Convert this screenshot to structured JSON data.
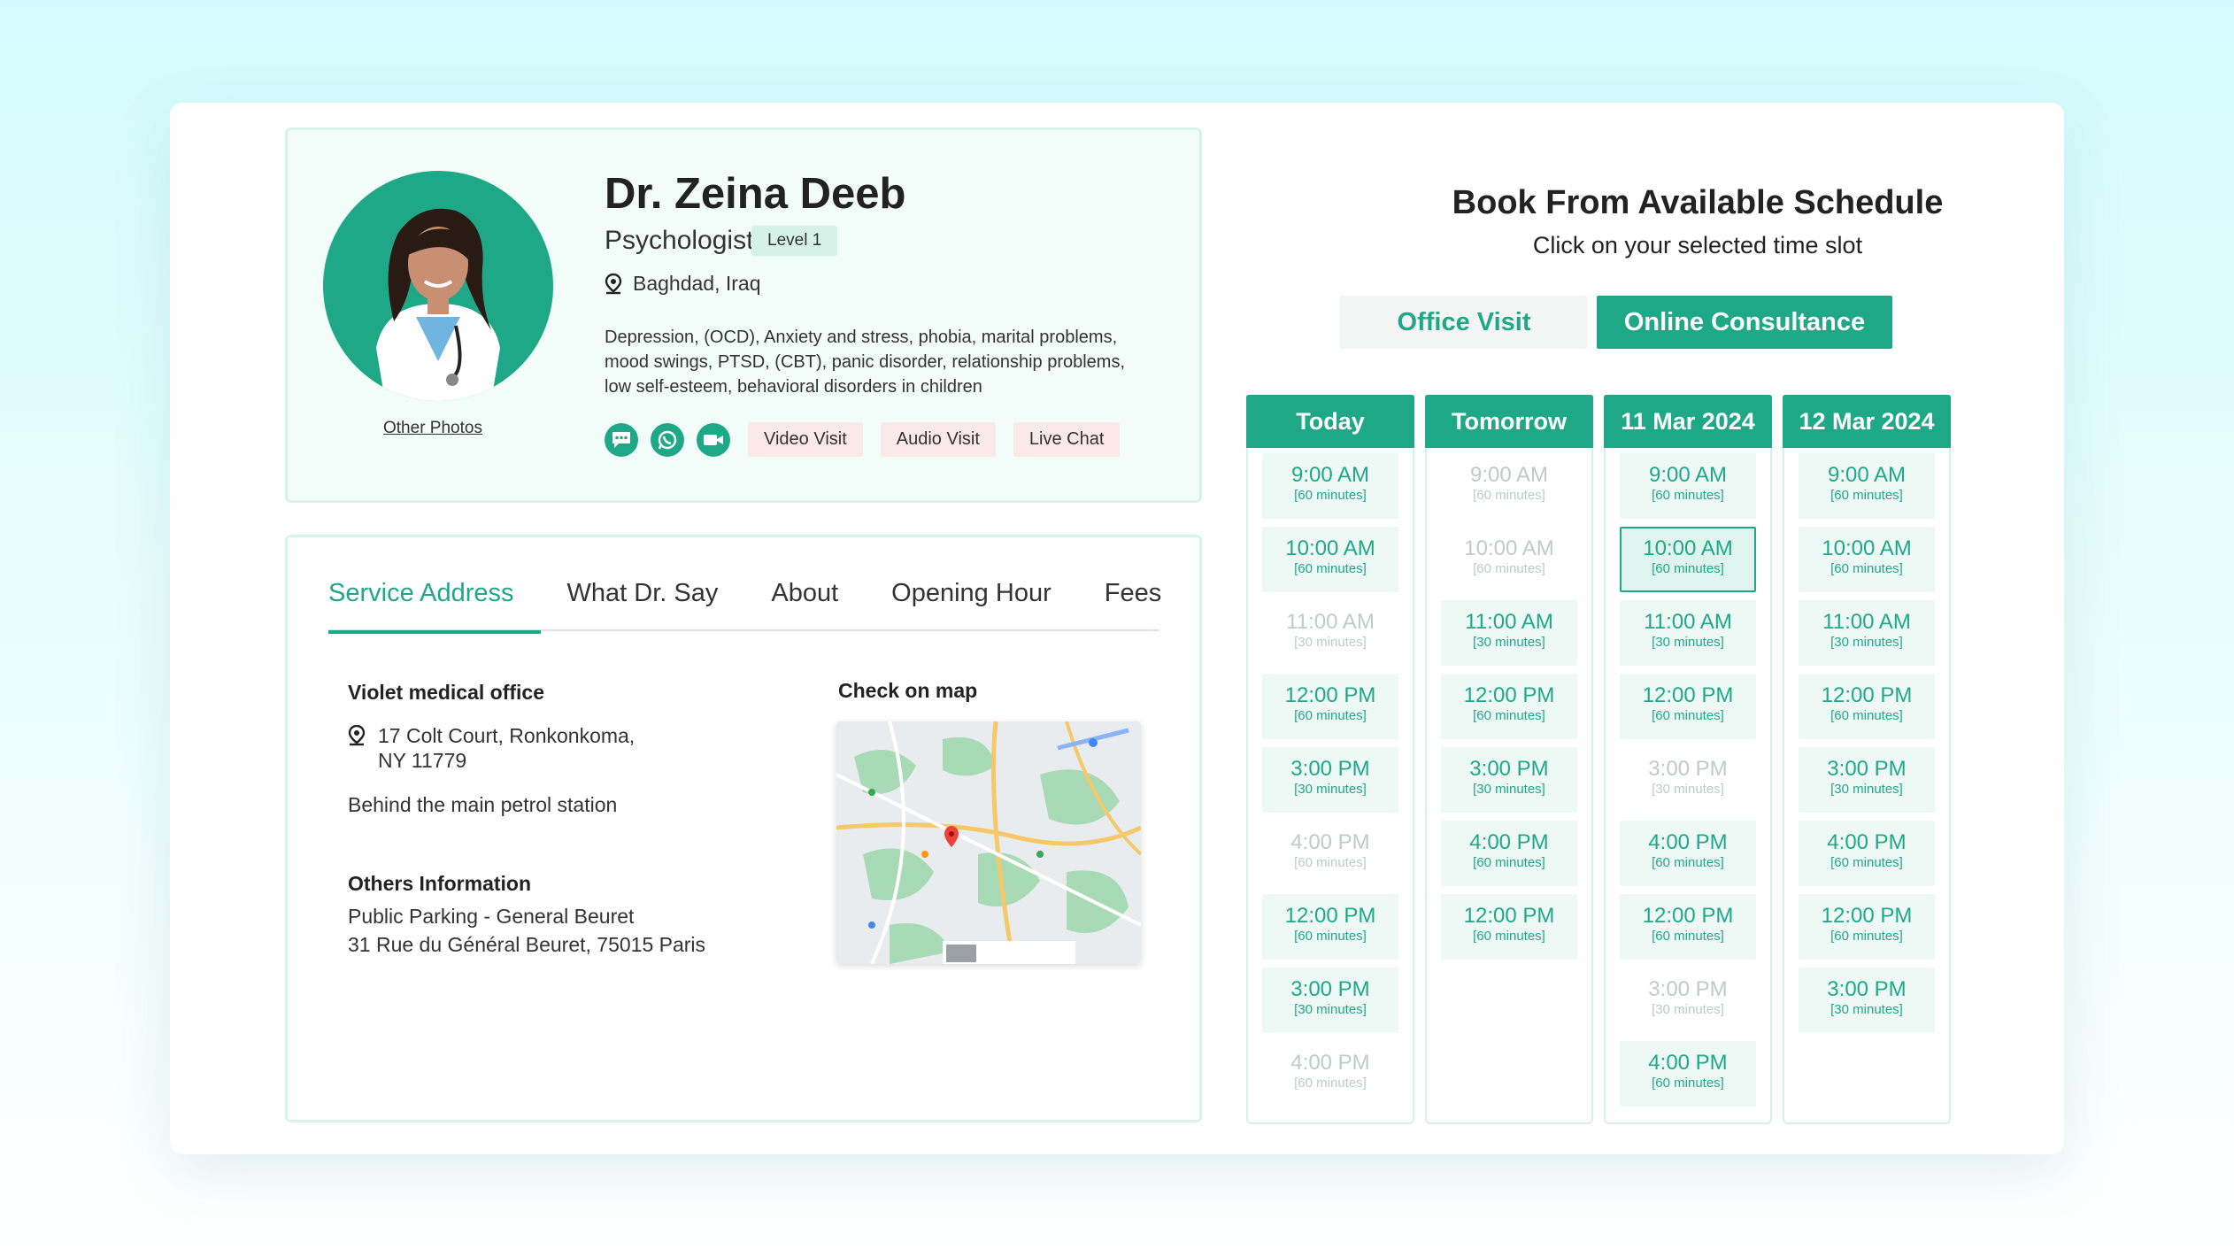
{
  "doctor": {
    "name": "Dr. Zeina Deeb",
    "role": "Psychologist",
    "level": "Level 1",
    "location": "Baghdad, Iraq",
    "specialties": "Depression, (OCD), Anxiety and stress, phobia, marital problems, mood swings, PTSD, (CBT), panic disorder, relationship problems, low self-esteem, behavioral disorders in children",
    "other_photos": "Other Photos",
    "actions": [
      "Video Visit",
      "Audio Visit",
      "Live Chat"
    ]
  },
  "tabs": [
    "Service Address",
    "What Dr. Say",
    "About",
    "Opening Hour",
    "Fees"
  ],
  "service": {
    "office_name": "Violet medical office",
    "address_line1": "17 Colt Court, Ronkonkoma,",
    "address_line2": "NY 11779",
    "landmark": "Behind the main petrol station",
    "others_title": "Others Information",
    "others_line1": "Public Parking - General Beuret",
    "others_line2": "31 Rue du Général Beuret, 75015 Paris",
    "map_title": "Check on map"
  },
  "booking": {
    "title": "Book From Available Schedule",
    "subtitle": "Click on your selected time slot",
    "office_visit": "Office Visit",
    "online_consultance": "Online Consultance",
    "columns": [
      {
        "day": "Today",
        "slots": [
          {
            "time": "9:00 AM",
            "dur": "[60 minutes]",
            "status": "available"
          },
          {
            "time": "10:00 AM",
            "dur": "[60 minutes]",
            "status": "available"
          },
          {
            "time": "11:00 AM",
            "dur": "[30 minutes]",
            "status": "unavailable"
          },
          {
            "time": "12:00 PM",
            "dur": "[60 minutes]",
            "status": "available"
          },
          {
            "time": "3:00 PM",
            "dur": "[30 minutes]",
            "status": "available"
          },
          {
            "time": "4:00 PM",
            "dur": "[60 minutes]",
            "status": "unavailable"
          },
          {
            "time": "12:00 PM",
            "dur": "[60 minutes]",
            "status": "available"
          },
          {
            "time": "3:00 PM",
            "dur": "[30 minutes]",
            "status": "available"
          },
          {
            "time": "4:00 PM",
            "dur": "[60 minutes]",
            "status": "unavailable"
          }
        ]
      },
      {
        "day": "Tomorrow",
        "slots": [
          {
            "time": "9:00 AM",
            "dur": "[60 minutes]",
            "status": "unavailable"
          },
          {
            "time": "10:00 AM",
            "dur": "[60 minutes]",
            "status": "unavailable"
          },
          {
            "time": "11:00 AM",
            "dur": "[30 minutes]",
            "status": "available"
          },
          {
            "time": "12:00 PM",
            "dur": "[60 minutes]",
            "status": "available"
          },
          {
            "time": "3:00 PM",
            "dur": "[30 minutes]",
            "status": "available"
          },
          {
            "time": "4:00 PM",
            "dur": "[60 minutes]",
            "status": "available"
          },
          {
            "time": "12:00 PM",
            "dur": "[60 minutes]",
            "status": "available"
          }
        ]
      },
      {
        "day": "11 Mar 2024",
        "slots": [
          {
            "time": "9:00 AM",
            "dur": "[60 minutes]",
            "status": "available"
          },
          {
            "time": "10:00 AM",
            "dur": "[60 minutes]",
            "status": "selected"
          },
          {
            "time": "11:00 AM",
            "dur": "[30 minutes]",
            "status": "available"
          },
          {
            "time": "12:00 PM",
            "dur": "[60 minutes]",
            "status": "available"
          },
          {
            "time": "3:00 PM",
            "dur": "[30 minutes]",
            "status": "unavailable"
          },
          {
            "time": "4:00 PM",
            "dur": "[60 minutes]",
            "status": "available"
          },
          {
            "time": "12:00 PM",
            "dur": "[60 minutes]",
            "status": "available"
          },
          {
            "time": "3:00 PM",
            "dur": "[30 minutes]",
            "status": "unavailable"
          },
          {
            "time": "4:00 PM",
            "dur": "[60 minutes]",
            "status": "available"
          }
        ]
      },
      {
        "day": "12 Mar 2024",
        "slots": [
          {
            "time": "9:00 AM",
            "dur": "[60 minutes]",
            "status": "available"
          },
          {
            "time": "10:00 AM",
            "dur": "[60 minutes]",
            "status": "available"
          },
          {
            "time": "11:00 AM",
            "dur": "[30 minutes]",
            "status": "available"
          },
          {
            "time": "12:00 PM",
            "dur": "[60 minutes]",
            "status": "available"
          },
          {
            "time": "3:00 PM",
            "dur": "[30 minutes]",
            "status": "available"
          },
          {
            "time": "4:00 PM",
            "dur": "[60 minutes]",
            "status": "available"
          },
          {
            "time": "12:00 PM",
            "dur": "[60 minutes]",
            "status": "available"
          },
          {
            "time": "3:00 PM",
            "dur": "[30 minutes]",
            "status": "available"
          }
        ]
      }
    ]
  },
  "colors": {
    "accent": "#1fa887",
    "panel_bg": "#f2fcf8",
    "action_bg": "#fbe8e8",
    "disabled": "#c4c8c8"
  },
  "icons": [
    "chat-bubble-icon",
    "whatsapp-icon",
    "video-camera-icon",
    "location-pin-icon"
  ]
}
